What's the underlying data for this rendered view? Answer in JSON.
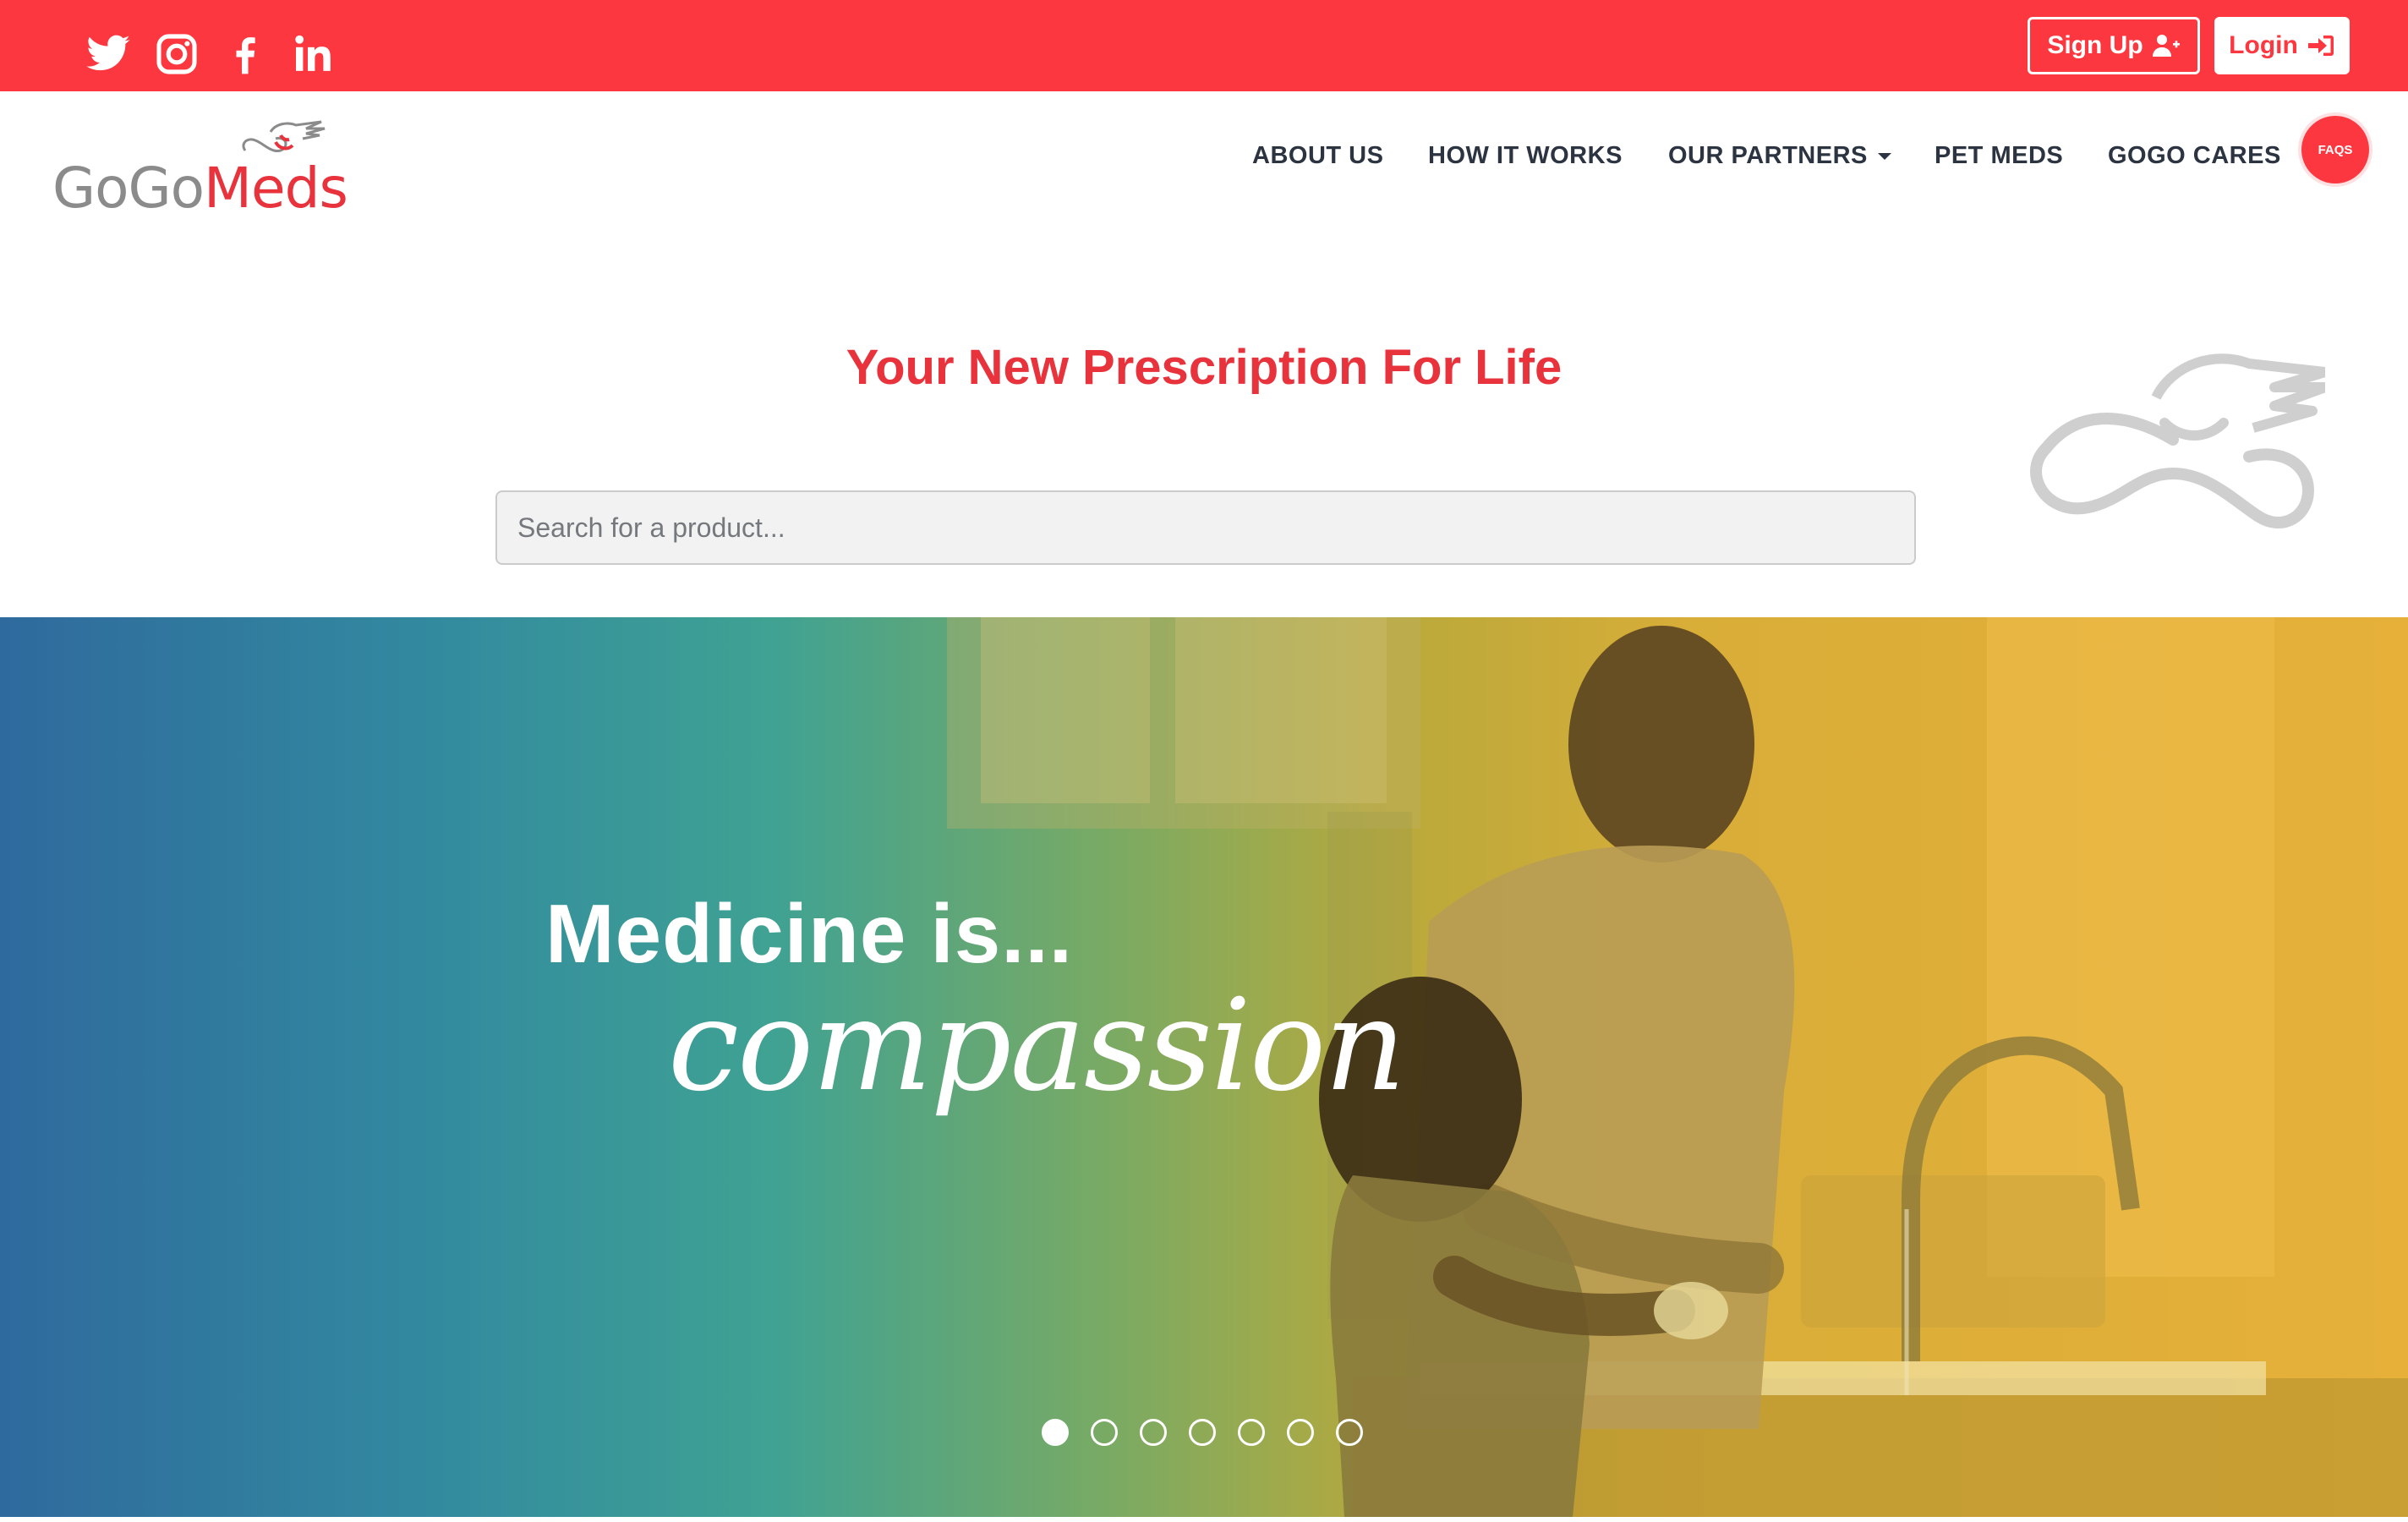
{
  "topbar": {
    "social": [
      {
        "icon": "twitter-icon"
      },
      {
        "icon": "instagram-icon"
      },
      {
        "icon": "facebook-icon"
      },
      {
        "icon": "linkedin-icon"
      }
    ],
    "signup_label": "Sign Up",
    "login_label": "Login",
    "brand_color": "#fd373f"
  },
  "logo": {
    "part1": "GoGo",
    "part2": "Meds"
  },
  "nav": {
    "items": [
      {
        "label": "ABOUT US"
      },
      {
        "label": "HOW IT WORKS"
      },
      {
        "label": "OUR PARTNERS"
      },
      {
        "label": "PET MEDS"
      },
      {
        "label": "GOGO CARES"
      }
    ],
    "faq_label": "FAQS"
  },
  "hero": {
    "tagline": "Your New Prescription For Life",
    "search_placeholder": "Search for a product..."
  },
  "banner": {
    "headline": "Medicine is...",
    "script": "compassion",
    "slide_count": 7,
    "active_slide": 1
  }
}
